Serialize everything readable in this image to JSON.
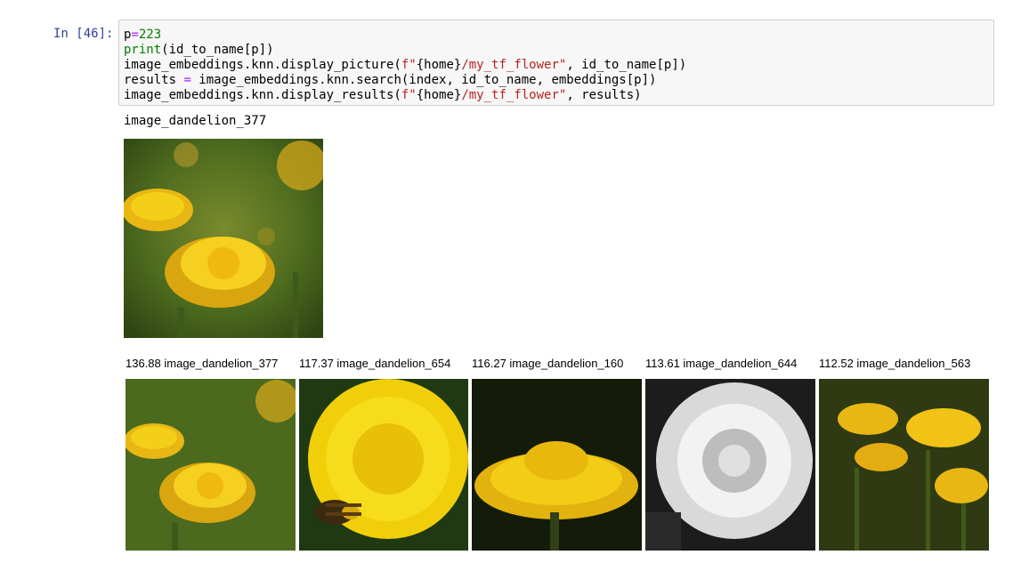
{
  "cell": {
    "prompt": "In [46]:",
    "code": {
      "line1_var": "p",
      "line1_op": "=",
      "line1_num": "223",
      "line2_fn": "print",
      "line2_rest": "(id_to_name[p])",
      "line3_a": "image_embeddings.knn.display_picture(",
      "line3_f": "f\"",
      "line3_home": "{home}",
      "line3_path": "/my_tf_flower\"",
      "line3_b": ", id_to_name[p])",
      "line4_a": "results ",
      "line4_op": "=",
      "line4_b": " image_embeddings.knn.search(index, id_to_name, embeddings[p])",
      "line5_a": "image_embeddings.knn.display_results(",
      "line5_f": "f\"",
      "line5_home": "{home}",
      "line5_path": "/my_tf_flower\"",
      "line5_b": ", results)"
    }
  },
  "output": {
    "printed_name": "image_dandelion_377",
    "query_image": {
      "alt": "dandelion flower photo",
      "icon": "dandelion-image"
    },
    "results": [
      {
        "score": "136.88",
        "name": "image_dandelion_377",
        "label": "136.88 image_dandelion_377"
      },
      {
        "score": "117.37",
        "name": "image_dandelion_654",
        "label": "117.37 image_dandelion_654"
      },
      {
        "score": "116.27",
        "name": "image_dandelion_160",
        "label": "116.27 image_dandelion_160"
      },
      {
        "score": "113.61",
        "name": "image_dandelion_644",
        "label": "113.61 image_dandelion_644"
      },
      {
        "score": "112.52",
        "name": "image_dandelion_563",
        "label": "112.52 image_dandelion_563"
      }
    ]
  },
  "colors": {
    "prompt": "#303f9f",
    "cell_bg": "#f7f7f7",
    "dandelion_yellow": "#f2c80f"
  }
}
